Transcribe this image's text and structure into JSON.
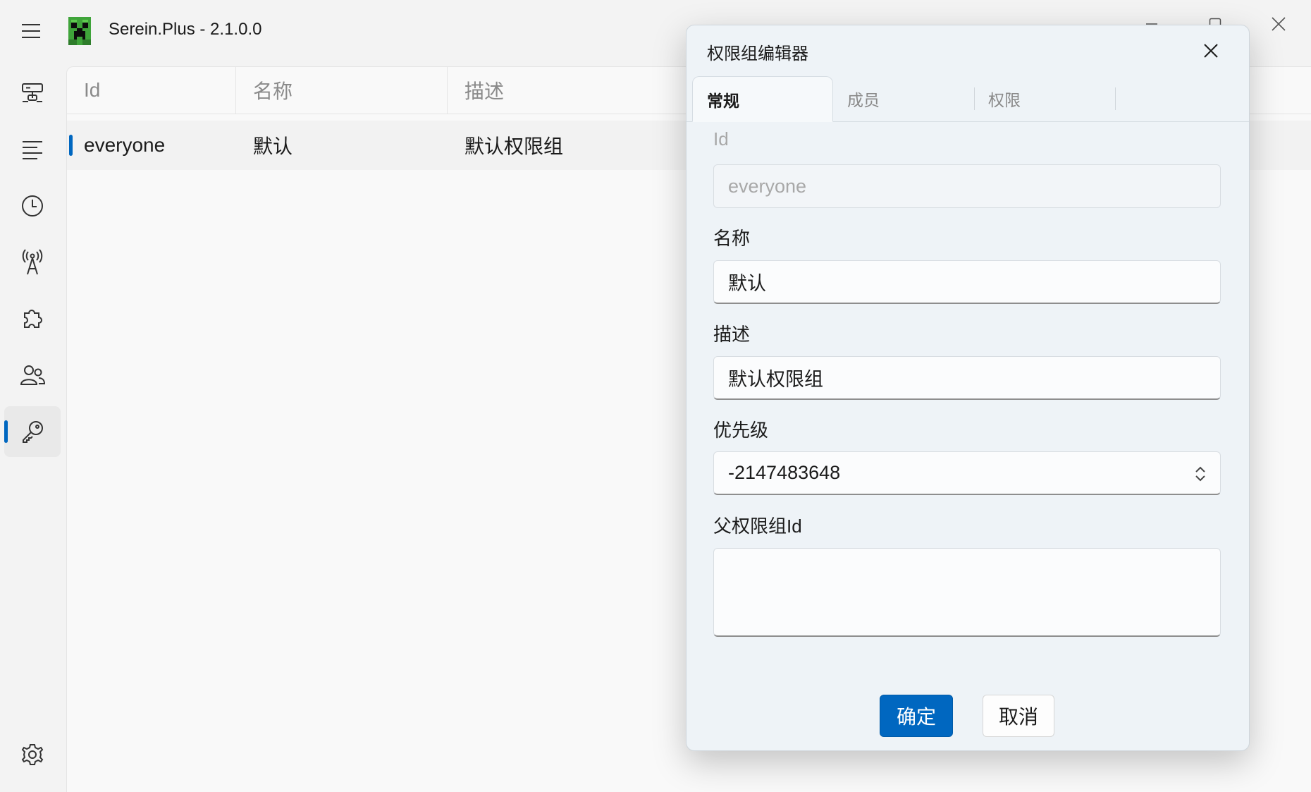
{
  "titlebar": {
    "title": "Serein.Plus - 2.1.0.0",
    "menu_icon": "hamburger-icon",
    "logo_icon": "creeper-logo",
    "controls": [
      "minimize-icon",
      "maximize-icon",
      "close-icon"
    ]
  },
  "nav": {
    "items": [
      {
        "icon": "server-icon"
      },
      {
        "icon": "list-icon"
      },
      {
        "icon": "clock-icon"
      },
      {
        "icon": "antenna-icon"
      },
      {
        "icon": "puzzle-icon"
      },
      {
        "icon": "people-icon"
      },
      {
        "icon": "key-icon",
        "active": true
      }
    ],
    "settings_icon": "gear-icon"
  },
  "grid": {
    "columns": [
      "Id",
      "名称",
      "描述"
    ],
    "rows": [
      {
        "id": "everyone",
        "name": "默认",
        "description": "默认权限组"
      }
    ]
  },
  "dialog": {
    "title": "权限组编辑器",
    "tabs": [
      "常规",
      "成员",
      "权限"
    ],
    "active_tab": "常规",
    "fields": {
      "id_label": "Id",
      "id_value": "everyone",
      "name_label": "名称",
      "name_value": "默认",
      "description_label": "描述",
      "description_value": "默认权限组",
      "priority_label": "优先级",
      "priority_value": "-2147483648",
      "parent_label": "父权限组Id",
      "parent_value": ""
    },
    "confirm_label": "确定",
    "cancel_label": "取消"
  },
  "colors": {
    "accent": "#0067c0",
    "window_bg": "#f3f3f3",
    "dialog_bg": "#eef3f7"
  }
}
